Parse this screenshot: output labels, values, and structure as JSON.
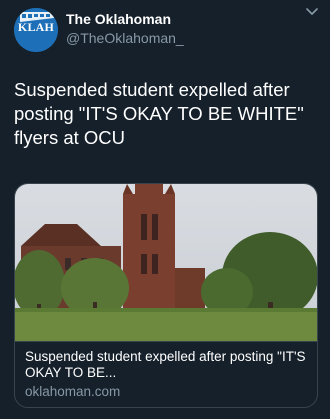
{
  "tweet": {
    "author": {
      "display_name": "The Oklahoman",
      "handle": "@TheOklahoman_",
      "avatar_text": "KLAH"
    },
    "text": "Suspended student expelled after posting \"IT'S OKAY TO BE WHITE\" flyers at OCU",
    "link_card": {
      "title": "Suspended student expelled after posting \"IT'S OKAY TO BE...",
      "domain": "oklahoman.com",
      "image_icon": "building-photo"
    },
    "menu_icon": "chevron-down-icon"
  },
  "colors": {
    "background": "#15202b",
    "text_primary": "#ffffff",
    "text_secondary": "#8899a6",
    "border": "#38444d",
    "avatar_bg": "#1d6fb8"
  }
}
